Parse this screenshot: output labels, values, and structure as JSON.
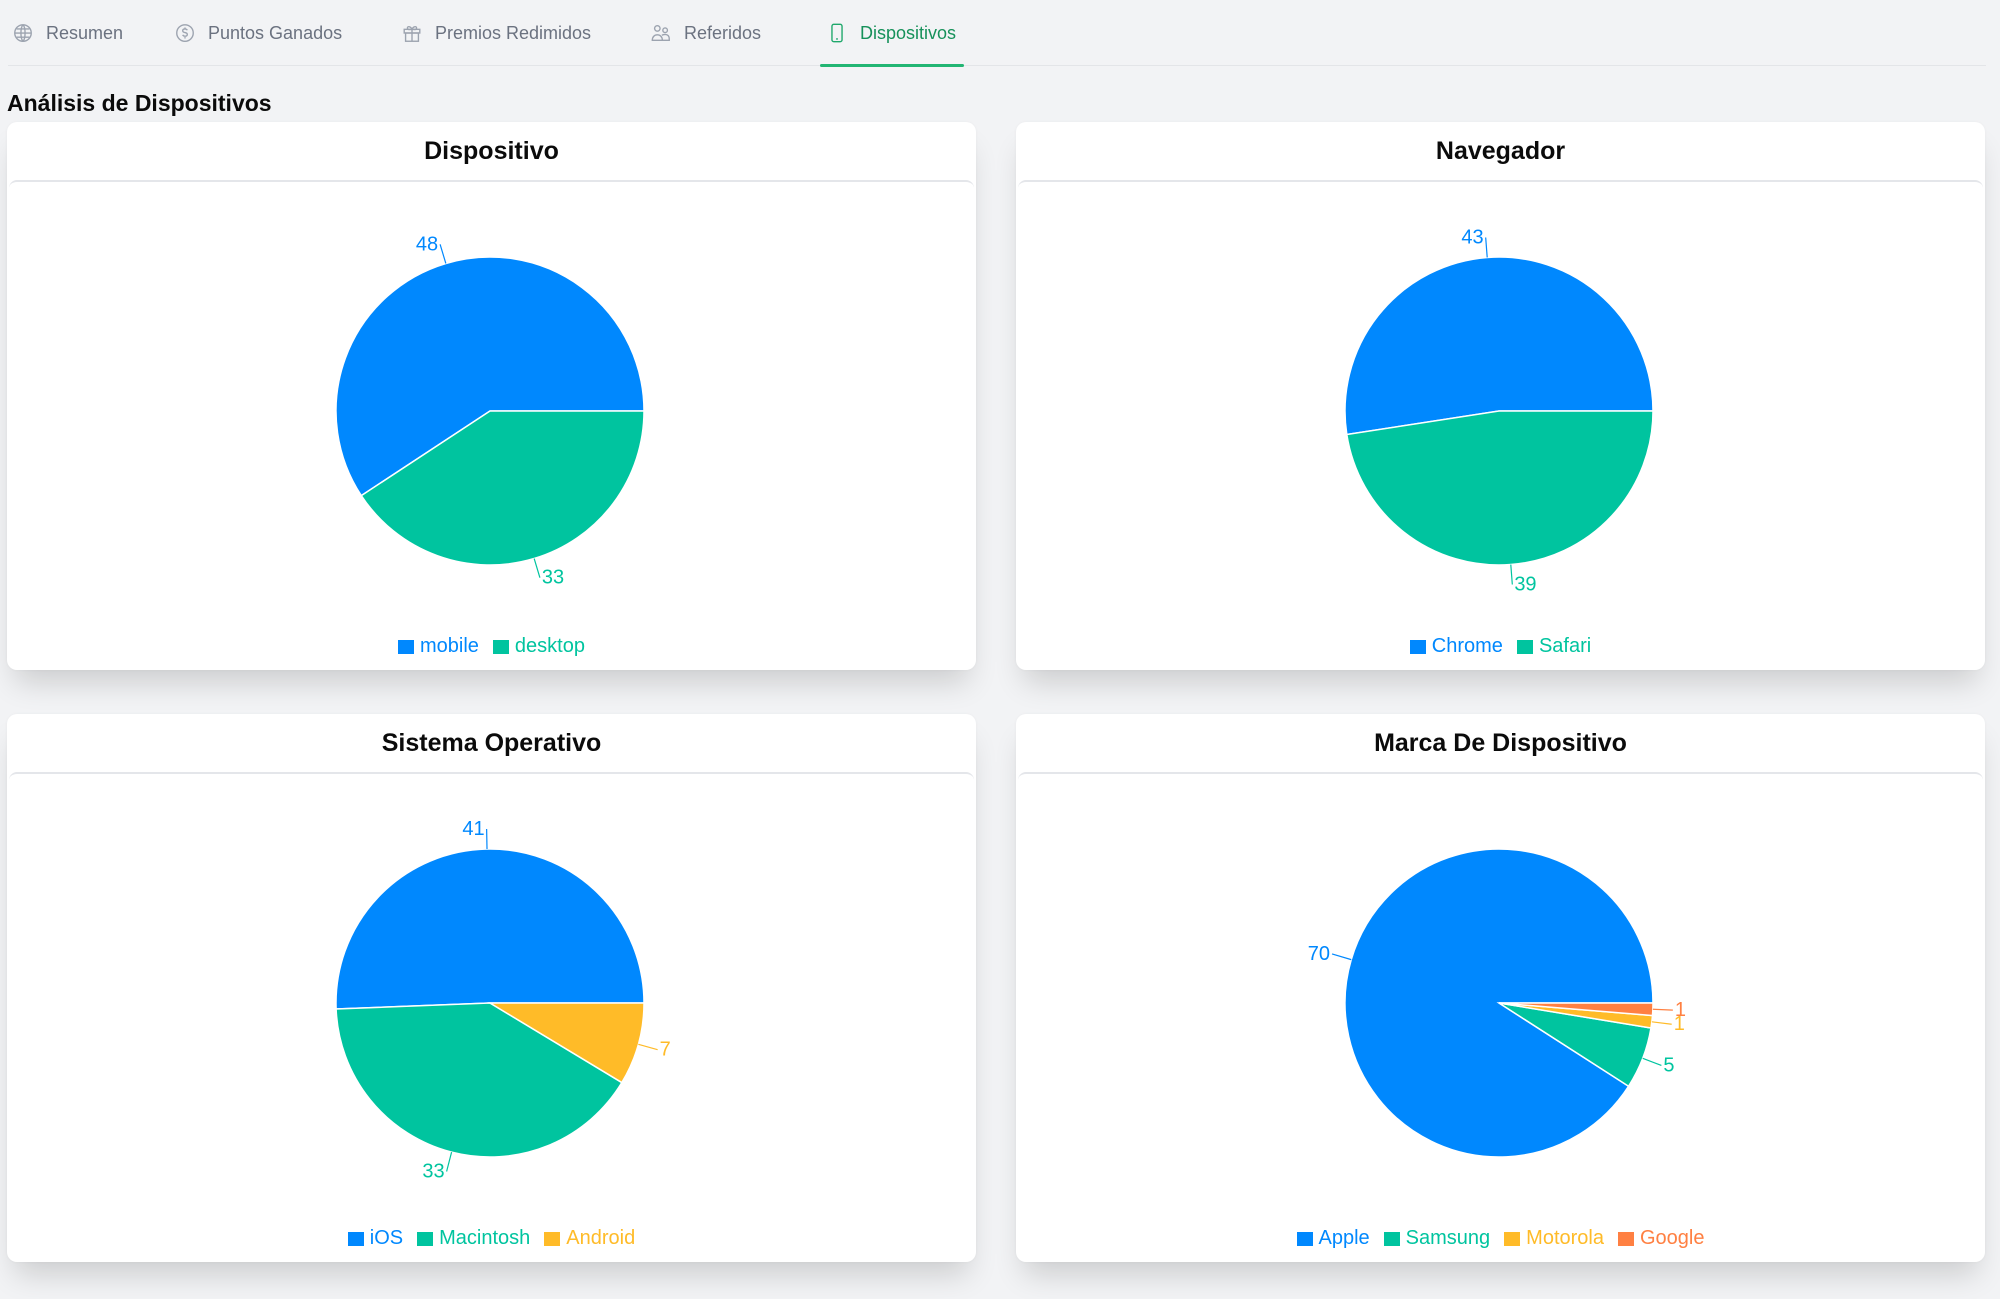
{
  "tabs": [
    {
      "label": "Resumen",
      "icon": "globe-icon",
      "active": false
    },
    {
      "label": "Puntos Ganados",
      "icon": "dollar-circle-icon",
      "active": false
    },
    {
      "label": "Premios Redimidos",
      "icon": "gift-icon",
      "active": false
    },
    {
      "label": "Referidos",
      "icon": "users-icon",
      "active": false
    },
    {
      "label": "Dispositivos",
      "icon": "smartphone-icon",
      "active": true
    }
  ],
  "page_title": "Análisis de Dispositivos",
  "colors": {
    "blue": "#0088FE",
    "green": "#00C49F",
    "yellow": "#FFBB28",
    "orange": "#FF8042",
    "active_tab": "#16915a"
  },
  "chart_data": [
    {
      "type": "pie",
      "title": "Dispositivo",
      "categories": [
        "mobile",
        "desktop"
      ],
      "values": [
        48,
        33
      ],
      "colors": [
        "#0088FE",
        "#00C49F"
      ],
      "legend": "bottom"
    },
    {
      "type": "pie",
      "title": "Navegador",
      "categories": [
        "Chrome",
        "Safari"
      ],
      "values": [
        43,
        39
      ],
      "colors": [
        "#0088FE",
        "#00C49F"
      ],
      "legend": "bottom"
    },
    {
      "type": "pie",
      "title": "Sistema Operativo",
      "categories": [
        "iOS",
        "Macintosh",
        "Android"
      ],
      "values": [
        41,
        33,
        7
      ],
      "colors": [
        "#0088FE",
        "#00C49F",
        "#FFBB28"
      ],
      "legend": "bottom"
    },
    {
      "type": "pie",
      "title": "Marca De Dispositivo",
      "categories": [
        "Apple",
        "Samsung",
        "Motorola",
        "Google"
      ],
      "values": [
        70,
        5,
        1,
        1
      ],
      "colors": [
        "#0088FE",
        "#00C49F",
        "#FFBB28",
        "#FF8042"
      ],
      "legend": "bottom"
    }
  ]
}
